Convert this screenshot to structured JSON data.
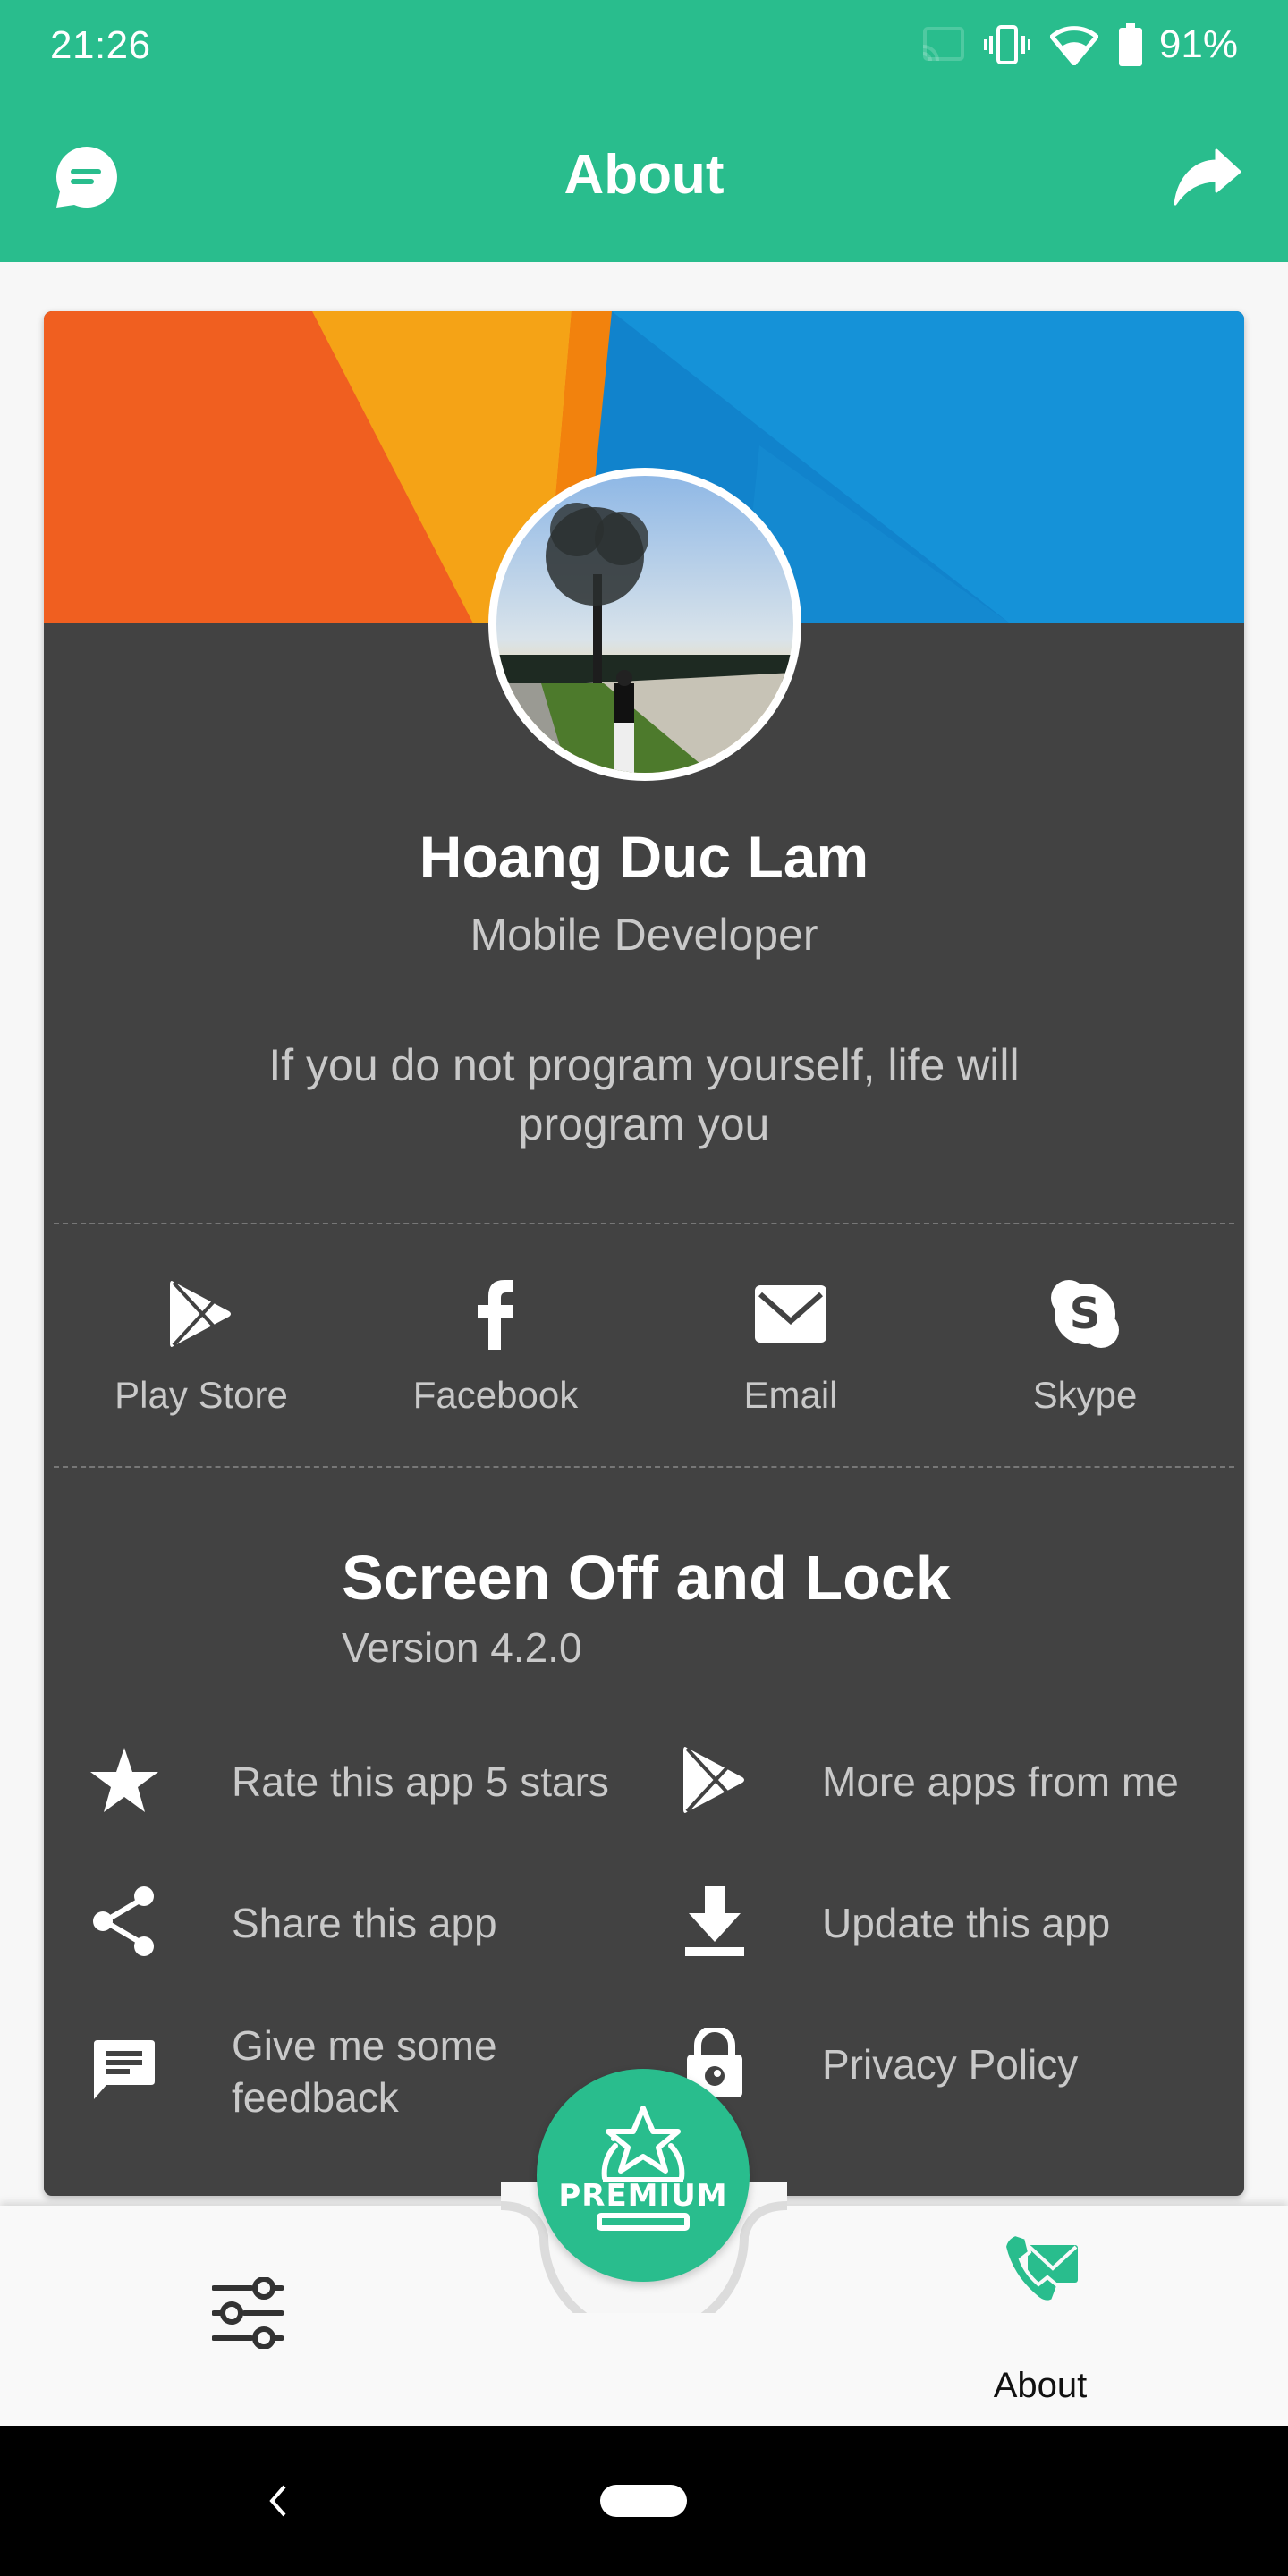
{
  "status_bar": {
    "time": "21:26",
    "icons": [
      "cast-icon",
      "vibrate-icon",
      "wifi-icon",
      "battery-icon"
    ],
    "battery_percent": "91%"
  },
  "app_bar": {
    "title": "About",
    "left_icon": "chat-icon",
    "right_icon": "share-arrow-icon"
  },
  "profile": {
    "name": "Hoang Duc Lam",
    "role": "Mobile Developer",
    "quote": "If you do not program yourself, life will program you"
  },
  "social": [
    {
      "label": "Play Store",
      "icon": "play-store-icon"
    },
    {
      "label": "Facebook",
      "icon": "facebook-icon"
    },
    {
      "label": "Email",
      "icon": "email-icon"
    },
    {
      "label": "Skype",
      "icon": "skype-icon"
    }
  ],
  "app_info": {
    "title": "Screen Off and Lock",
    "version": "Version 4.2.0"
  },
  "links": [
    {
      "label": "Rate this app 5 stars",
      "icon": "star-icon"
    },
    {
      "label": "More apps from me",
      "icon": "play-store-icon"
    },
    {
      "label": "Share this app",
      "icon": "share-icon"
    },
    {
      "label": "Update this app",
      "icon": "download-icon"
    },
    {
      "label": "Give me some feedback",
      "icon": "feedback-icon"
    },
    {
      "label": "Privacy Policy",
      "icon": "lock-icon"
    }
  ],
  "bottom_nav": {
    "fab_label": "PREMIUM",
    "tabs": [
      {
        "label": "",
        "icon": "sliders-icon",
        "active": false
      },
      {
        "label": "About",
        "icon": "contact-icon",
        "active": true
      }
    ]
  },
  "colors": {
    "accent": "#29bd8d",
    "card": "#424242",
    "background": "#f7f7f7",
    "text_secondary": "#c9c9c9"
  }
}
